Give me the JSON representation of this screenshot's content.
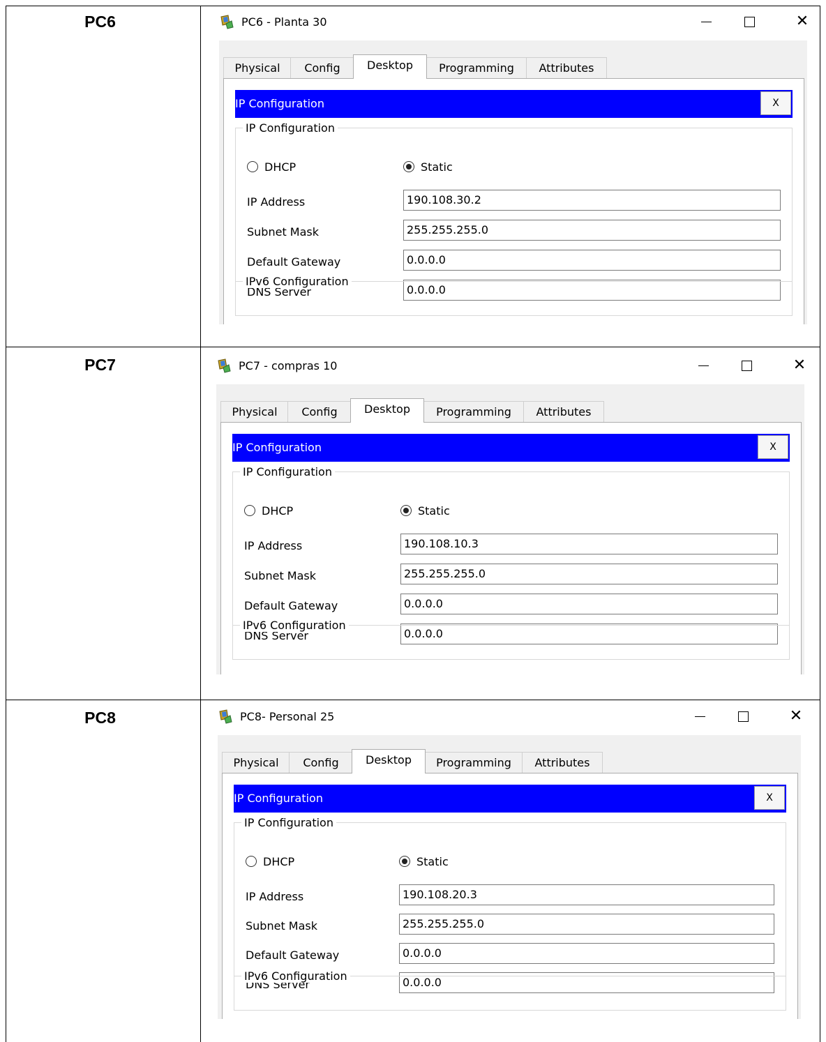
{
  "rows": [
    {
      "label": "PC6",
      "window": {
        "title": "PC6 - Planta 30",
        "tabs": [
          "Physical",
          "Config",
          "Desktop",
          "Programming",
          "Attributes"
        ],
        "active_tab": "Desktop",
        "panel_title": "IP Configuration",
        "panel_close": "X",
        "group_title": "IP Configuration",
        "dhcp_label": "DHCP",
        "static_label": "Static",
        "mode": "Static",
        "fields": [
          {
            "label": "IP Address",
            "value": "190.108.30.2"
          },
          {
            "label": "Subnet Mask",
            "value": "255.255.255.0"
          },
          {
            "label": "Default Gateway",
            "value": "0.0.0.0"
          },
          {
            "label": "DNS Server",
            "value": "0.0.0.0"
          }
        ],
        "ipv6_title": "IPv6 Configuration"
      }
    },
    {
      "label": "PC7",
      "window": {
        "title": "PC7 - compras 10",
        "tabs": [
          "Physical",
          "Config",
          "Desktop",
          "Programming",
          "Attributes"
        ],
        "active_tab": "Desktop",
        "panel_title": "IP Configuration",
        "panel_close": "X",
        "group_title": "IP Configuration",
        "dhcp_label": "DHCP",
        "static_label": "Static",
        "mode": "Static",
        "fields": [
          {
            "label": "IP Address",
            "value": "190.108.10.3"
          },
          {
            "label": "Subnet Mask",
            "value": "255.255.255.0"
          },
          {
            "label": "Default Gateway",
            "value": "0.0.0.0"
          },
          {
            "label": "DNS Server",
            "value": "0.0.0.0"
          }
        ],
        "ipv6_title": "IPv6 Configuration"
      }
    },
    {
      "label": "PC8",
      "window": {
        "title": "PC8- Personal 25",
        "tabs": [
          "Physical",
          "Config",
          "Desktop",
          "Programming",
          "Attributes"
        ],
        "active_tab": "Desktop",
        "panel_title": "IP Configuration",
        "panel_close": "X",
        "group_title": "IP Configuration",
        "dhcp_label": "DHCP",
        "static_label": "Static",
        "mode": "Static",
        "fields": [
          {
            "label": "IP Address",
            "value": "190.108.20.3"
          },
          {
            "label": "Subnet Mask",
            "value": "255.255.255.0"
          },
          {
            "label": "Default Gateway",
            "value": "0.0.0.0"
          },
          {
            "label": "DNS Server",
            "value": "0.0.0.0"
          }
        ],
        "ipv6_title": "IPv6 Configuration"
      }
    }
  ],
  "colors": {
    "panel_header": "#0000ff",
    "window_body": "#f0f0f0",
    "grid": "#000000"
  },
  "icons": {
    "window": "packet-tracer-pc-icon",
    "minimize": "minimize-icon",
    "maximize": "maximize-icon",
    "close": "close-icon"
  }
}
